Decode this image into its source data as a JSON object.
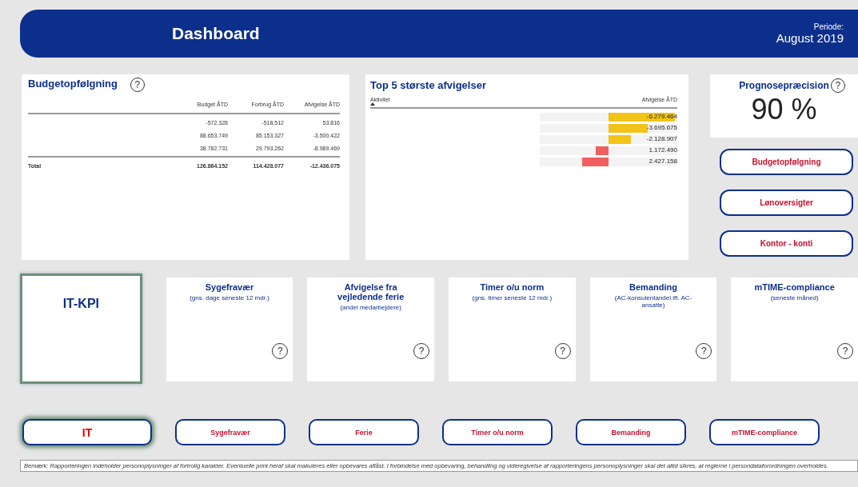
{
  "header": {
    "title": "Dashboard",
    "period_label": "Periode:",
    "period": "August 2019"
  },
  "budget": {
    "title": "Budgetopfølgning",
    "help": "?",
    "columns": [
      "Budget ÅTD",
      "Forbrug ÅTD",
      "Afvigelse ÅTD"
    ],
    "rows": [
      {
        "cells": [
          "-572.328",
          "-518.512",
          "53.816"
        ]
      },
      {
        "cells": [
          "88.653.749",
          "85.153.327",
          "-3.500.422"
        ]
      },
      {
        "cells": [
          "38.782.731",
          "29.793.262",
          "-8.989.469"
        ]
      }
    ],
    "total": {
      "label": "Total",
      "cells": [
        "126.864.152",
        "114.428.077",
        "-12.436.075"
      ]
    }
  },
  "top5": {
    "title": "Top 5 største afvigelser",
    "column_1": "Aktivitet",
    "column_2": "Afvigelse ÅTD",
    "rows": [
      {
        "kind": "negative",
        "value": "-6.279.464",
        "level": 0.97,
        "color": "#f2c318"
      },
      {
        "kind": "negative",
        "value": "-3.695.675",
        "level": 0.57,
        "color": "#f2c318"
      },
      {
        "kind": "negative",
        "value": "-2.128.907",
        "level": 0.33,
        "color": "#f2c318"
      },
      {
        "kind": "positive",
        "value": "1.172.490",
        "level": 0.19,
        "color": "#f06060"
      },
      {
        "kind": "positive",
        "value": "2.427.158",
        "level": 0.38,
        "color": "#f06060"
      }
    ]
  },
  "forecast": {
    "title": "Prognosepræcision",
    "value": "90 %",
    "help": "?"
  },
  "nav_buttons": [
    "Budgetopfølgning",
    "Lønoversigter",
    "Kontor - konti"
  ],
  "kpi_title": "IT-KPI",
  "kpis": [
    {
      "title": "Sygefravær",
      "subtitle": "(gns. dage seneste 12 mdr.)",
      "help": "?"
    },
    {
      "title": "Afvigelse fra vejledende ferie",
      "subtitle": "(andel medarbejdere)",
      "help": "?"
    },
    {
      "title": "Timer o/u norm",
      "subtitle": "(gns. timer seneste 12 mdr.)",
      "help": "?"
    },
    {
      "title": "Bemanding",
      "subtitle": "(AC-konsulentandel ift. AC-ansatte)",
      "help": "?"
    },
    {
      "title": "mTIME-compliance",
      "subtitle": "(seneste måned)",
      "help": "?"
    }
  ],
  "bottom_buttons": [
    {
      "label": "IT",
      "selected": true
    },
    {
      "label": "Sygefravær",
      "selected": false
    },
    {
      "label": "Ferie",
      "selected": false
    },
    {
      "label": "Timer o/u norm",
      "selected": false
    },
    {
      "label": "Bemanding",
      "selected": false
    },
    {
      "label": "mTIME-compliance",
      "selected": false
    }
  ],
  "note": "Bemærk: Rapporteringen indeholder personoplysninger af fortrolig karakter. Eventuelle print heraf skal makuleres eller opbevares aflåst. I forbindelse med opbevaring, behandling og videregivelse af rapporteringens personoplysninger skal det altid sikres, at reglerne i persondataforordningen overholdes."
}
